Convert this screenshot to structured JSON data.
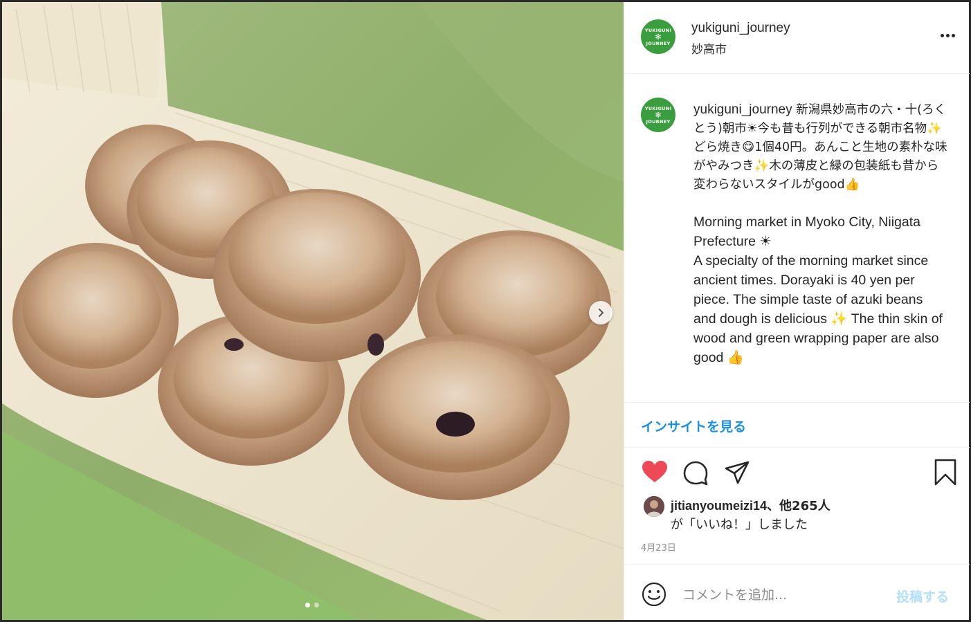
{
  "post": {
    "username": "yukiguni_journey",
    "location": "妙高市",
    "avatar_text_top": "YUKIGUNI",
    "avatar_text_bottom": "JOURNEY",
    "avatar_color": "#3a9e3e"
  },
  "caption": {
    "username": "yukiguni_journey",
    "jp_text": " 新潟県妙高市の六・十(ろくとう)朝市☀今も昔も行列ができる朝市名物✨どら焼き😋1個40円。あんこと生地の素朴な味がやみつき✨木の薄皮と緑の包装紙も昔から変わらないスタイルがgood👍",
    "en_text": "Morning market in Myoko City, Niigata Prefecture ☀\nA specialty of the morning market since ancient times. Dorayaki is 40 yen per piece. The simple taste of azuki beans and dough is delicious ✨ The thin skin of wood and green wrapping paper are also good 👍"
  },
  "insight": {
    "label": "インサイトを見る",
    "color": "#1a8fe3"
  },
  "actions": {
    "like_icon": "heart-icon",
    "comment_icon": "comment-icon",
    "share_icon": "send-icon",
    "save_icon": "bookmark-icon",
    "liked": true,
    "like_color": "#ed4956"
  },
  "likes": {
    "user": "jitianyoumeizi14",
    "others": "、他265人",
    "suffix": "が「いいね！」しました"
  },
  "date": "4月23日",
  "comment": {
    "placeholder": "コメントを追加...",
    "post_label": "投稿する"
  },
  "carousel": {
    "total": 2,
    "current": 1,
    "next_icon": "chevron-right-icon"
  }
}
